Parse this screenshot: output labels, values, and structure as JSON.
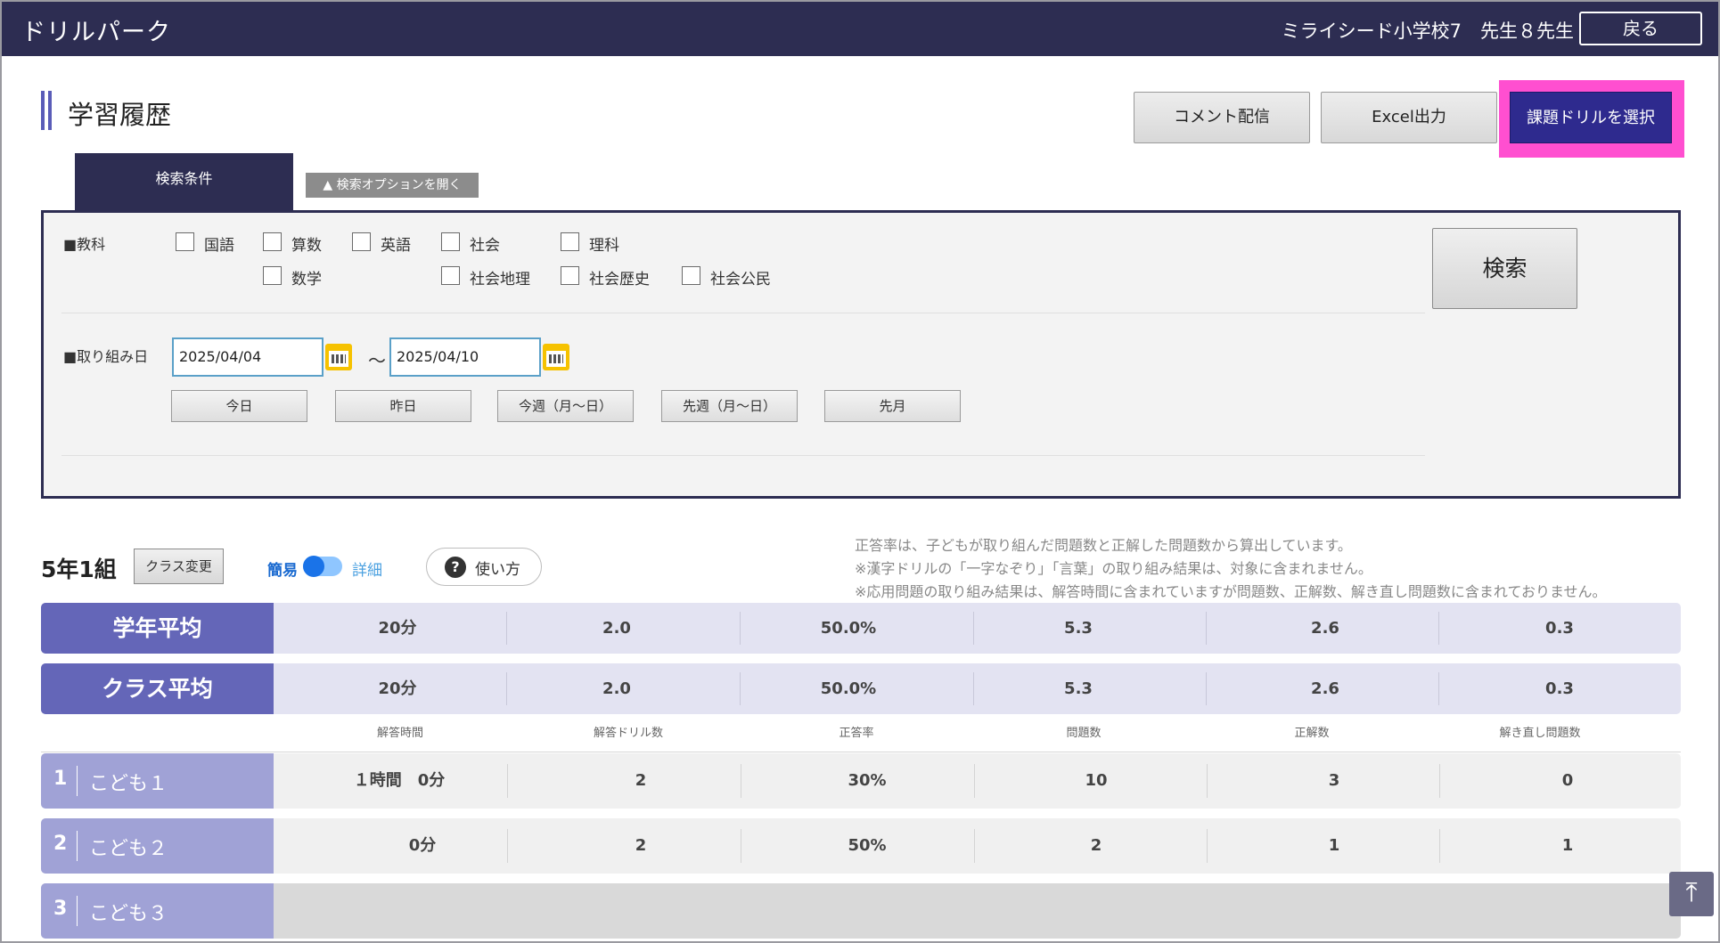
{
  "header": {
    "brand": "ドリルパーク",
    "school": "ミライシード小学校7",
    "teacher": "先生８先生",
    "back_label": "戻る"
  },
  "page": {
    "title": "学習履歴",
    "buttons": {
      "comment": "コメント配信",
      "excel": "Excel出力",
      "assign": "課題ドリルを選択"
    }
  },
  "search": {
    "tab_label": "検索条件",
    "option_label": "▲ 検索オプションを開く",
    "subject_label": "■教科",
    "subjects": [
      "国語",
      "算数",
      "英語",
      "社会",
      "理科",
      "数学",
      "社会地理",
      "社会歴史",
      "社会公民"
    ],
    "date_label": "■取り組み日",
    "date_from": "2025/04/04",
    "date_to": "2025/04/10",
    "tilde": "～",
    "quick_ranges": [
      "今日",
      "昨日",
      "今週（月～日）",
      "先週（月～日）",
      "先月"
    ],
    "search_button": "検索"
  },
  "class_bar": {
    "class_name": "5年1組",
    "class_change": "クラス変更",
    "mode_simple": "簡易",
    "mode_detail": "詳細",
    "howto": "使い方",
    "notes": [
      "正答率は、子どもが取り組んだ問題数と正解した問題数から算出しています。",
      "※漢字ドリルの「一字なぞり」「言葉」の取り組み結果は、対象に含まれません。",
      "※応用問題の取り組み結果は、解答時間に含まれていますが問題数、正解数、解き直し問題数に含まれておりません。"
    ]
  },
  "table": {
    "columns": [
      "解答時間",
      "解答ドリル数",
      "正答率",
      "問題数",
      "正解数",
      "解き直し問題数"
    ],
    "grade_avg": {
      "label": "学年平均",
      "values": [
        "20分",
        "2.0",
        "50.0%",
        "5.3",
        "2.6",
        "0.3"
      ]
    },
    "class_avg": {
      "label": "クラス平均",
      "values": [
        "20分",
        "2.0",
        "50.0%",
        "5.3",
        "2.6",
        "0.3"
      ]
    },
    "students": [
      {
        "no": "1",
        "name": "こども１",
        "values": [
          "１時間　0分",
          "2",
          "30%",
          "10",
          "3",
          "0"
        ]
      },
      {
        "no": "2",
        "name": "こども２",
        "values": [
          "0分",
          "2",
          "50%",
          "2",
          "1",
          "1"
        ]
      },
      {
        "no": "3",
        "name": "こども３",
        "values": [
          "",
          "",
          "",
          "",
          "",
          ""
        ]
      }
    ]
  },
  "icons": {
    "to_top": "arrow-up-to-top-icon",
    "calendar": "calendar-icon",
    "help": "help-icon"
  }
}
